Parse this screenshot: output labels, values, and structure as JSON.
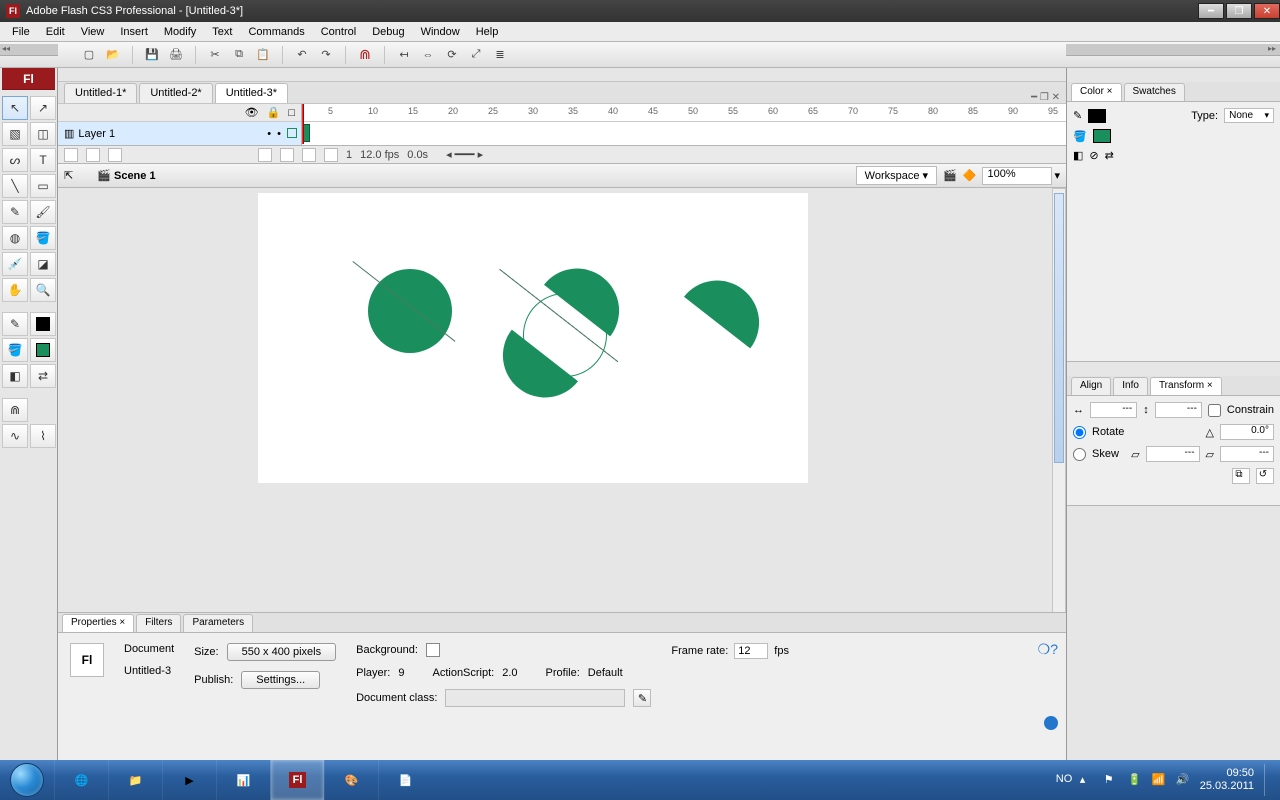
{
  "window": {
    "title": "Adobe Flash CS3 Professional - [Untitled-3*]"
  },
  "menu": [
    "File",
    "Edit",
    "View",
    "Insert",
    "Modify",
    "Text",
    "Commands",
    "Control",
    "Debug",
    "Window",
    "Help"
  ],
  "docTabs": [
    "Untitled-1*",
    "Untitled-2*",
    "Untitled-3*"
  ],
  "activeDocTab": 2,
  "layers": {
    "name": "Layer 1"
  },
  "ruler": {
    "ticks": [
      5,
      10,
      15,
      20,
      25,
      30,
      35,
      40,
      45,
      50,
      55,
      60,
      65,
      70,
      75,
      80,
      85,
      90,
      95
    ]
  },
  "timelineStatus": {
    "frame": "1",
    "fps": "12.0 fps",
    "time": "0.0s"
  },
  "sceneBar": {
    "scene": "Scene 1",
    "workspace": "Workspace ▾",
    "zoom": "100%"
  },
  "color": {
    "tabs": [
      "Color ×",
      "Swatches"
    ],
    "typeLabel": "Type:",
    "typeValue": "None"
  },
  "rightTabs2": [
    "Align",
    "Info",
    "Transform ×"
  ],
  "transform": {
    "w": "---",
    "h": "---",
    "constrain": "Constrain",
    "rotateLabel": "Rotate",
    "rotate": "0.0°",
    "skewLabel": "Skew",
    "skewH": "---",
    "skewV": "---"
  },
  "props": {
    "tabs": [
      "Properties ×",
      "Filters",
      "Parameters"
    ],
    "docType": "Document",
    "docName": "Untitled-3",
    "sizeLabel": "Size:",
    "sizeBtn": "550 x 400 pixels",
    "publishLabel": "Publish:",
    "publishBtn": "Settings...",
    "bgLabel": "Background:",
    "frLabel": "Frame rate:",
    "frVal": "12",
    "frUnit": "fps",
    "playerLabel": "Player:",
    "playerVal": "9",
    "asLabel": "ActionScript:",
    "asVal": "2.0",
    "profileLabel": "Profile:",
    "profileVal": "Default",
    "docClassLabel": "Document class:"
  },
  "tray": {
    "lang": "NO",
    "time": "09:50",
    "date": "25.03.2011"
  }
}
